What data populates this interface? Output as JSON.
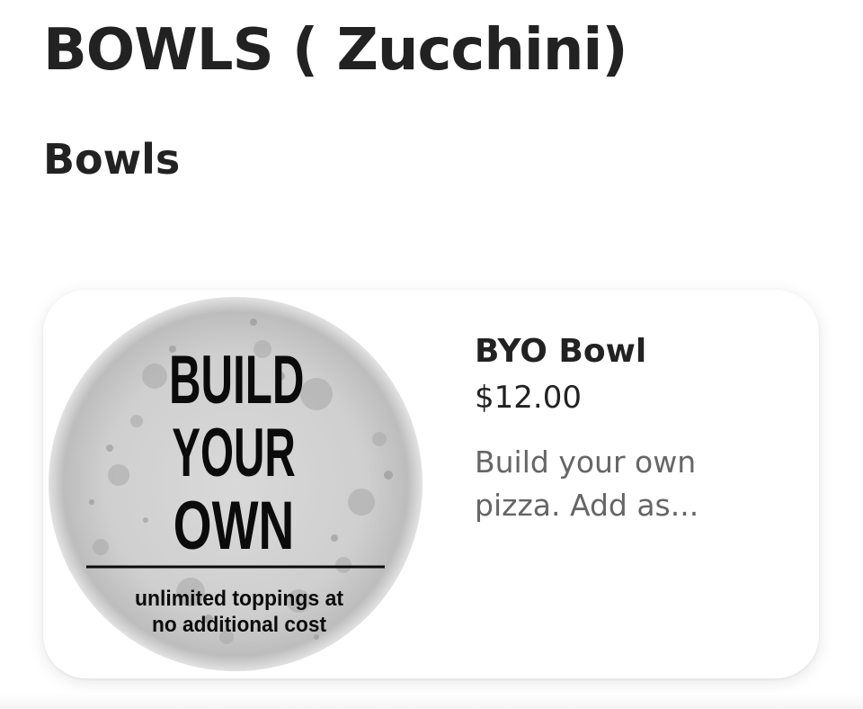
{
  "page": {
    "title": "BOWLS ( Zucchini)",
    "section_title": "Bowls"
  },
  "items": [
    {
      "name": "BYO Bowl",
      "price": "$12.00",
      "description": "Build your own pizza. Add as...",
      "image_text": {
        "line1": "BUILD",
        "line2": "YOUR",
        "line3": "OWN",
        "sub1": "unlimited toppings at",
        "sub2": "no additional cost"
      }
    }
  ],
  "colors": {
    "text": "#222222",
    "muted": "#666666",
    "card_bg": "#ffffff"
  }
}
